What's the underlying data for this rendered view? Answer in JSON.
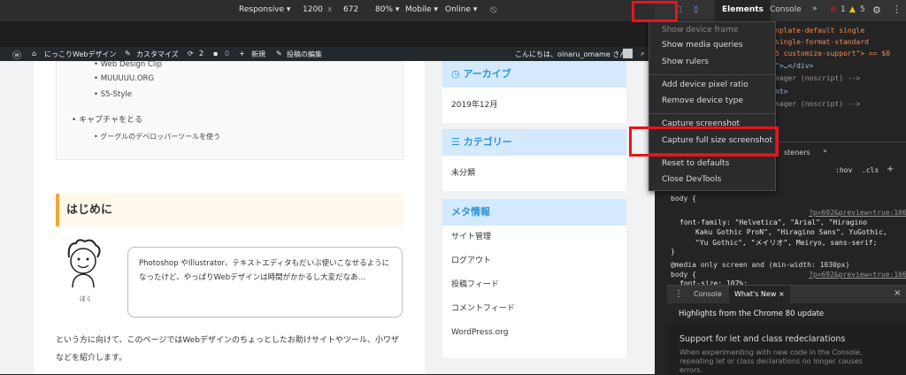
{
  "device_toolbar": {
    "device": "Responsive",
    "width": "1200",
    "x": "x",
    "height": "672",
    "zoom": "80%",
    "mode": "Mobile",
    "network": "Online"
  },
  "wp_admin_bar": {
    "site_name": "にっこりWebデザイン",
    "customize": "カスタマイズ",
    "updates_count": "2",
    "comments_count": "0",
    "new": "新規",
    "edit_post": "投稿の編集",
    "greeting": "こんにちは、oinaru_omame さん"
  },
  "article": {
    "toc_items": [
      "Web Design Clip",
      "MUUUUU.ORG",
      "S5-Style",
      "キャプチャをとる",
      "グーグルのデベロッパーツールを使う"
    ],
    "heading": "はじめに",
    "avatar_caption": "ぼく",
    "balloon_text": "Photoshop やIllustrator、テキストエディタもだいぶ使いこなせるようになったけど、やっぱりWebデザインは時間がかかるし大変だなあ…",
    "body_text": "という方に向けて、このページではWebデザインのちょっとしたお助けサイトやツール、小ワザなどを紹介します。"
  },
  "sidebar": {
    "archive": {
      "title": "アーカイブ",
      "items": [
        "2019年12月"
      ]
    },
    "category": {
      "title": "カテゴリー",
      "items": [
        "未分類"
      ]
    },
    "meta": {
      "title": "メタ情報",
      "items": [
        "サイト管理",
        "ログアウト",
        "投稿フィード",
        "コメントフィード",
        "WordPress.org"
      ]
    }
  },
  "devtools": {
    "tabs": {
      "elements": "Elements",
      "console": "Console"
    },
    "errors": "1",
    "warnings": "5",
    "code_lines": [
      "nplate-default single",
      "single-format-standard",
      "5 customize-support\"> == $0",
      "\">…</div>",
      "nager (noscript) -->",
      "nt>",
      "nager (noscript) -->"
    ],
    "styles_tabs": {
      "listeners": "steners",
      "hov": ":hov",
      ".cls": ".cls"
    },
    "css_lines": [
      "body {",
      "font-family: \"Helvetica\", \"Arial\", \"Hiragino",
      "Kaku Gothic ProN\", \"Hiragino Sans\", YuGothic,",
      "\"Yu Gothic\", \"メイリオ\", Meiryo, sans-serif;",
      "}",
      "@media only screen and (min-width: 1030px)",
      "body {",
      "font-size: 107%;"
    ],
    "css_source": "?p=692&preview=true:106",
    "drawer_tabs": {
      "console": "Console",
      "whats_new": "What's New"
    },
    "whats_new_heading": "Highlights from the Chrome 80 update",
    "news_title": "Support for let and class redeclarations",
    "news_body": "When experimenting with new code in the Console, repeating let or class declarations no longer causes errors."
  },
  "context_menu": {
    "items": [
      "Show device frame",
      "Show media queries",
      "Show rulers",
      "Add device pixel ratio",
      "Remove device type",
      "Capture screenshot",
      "Capture full size screenshot",
      "Reset to defaults",
      "Close DevTools"
    ]
  },
  "colors": {
    "highlight": "#e8141d",
    "widget_header": "#d4e9fb",
    "accent_blue": "#2d93dc",
    "heading_border": "#f0a830"
  }
}
